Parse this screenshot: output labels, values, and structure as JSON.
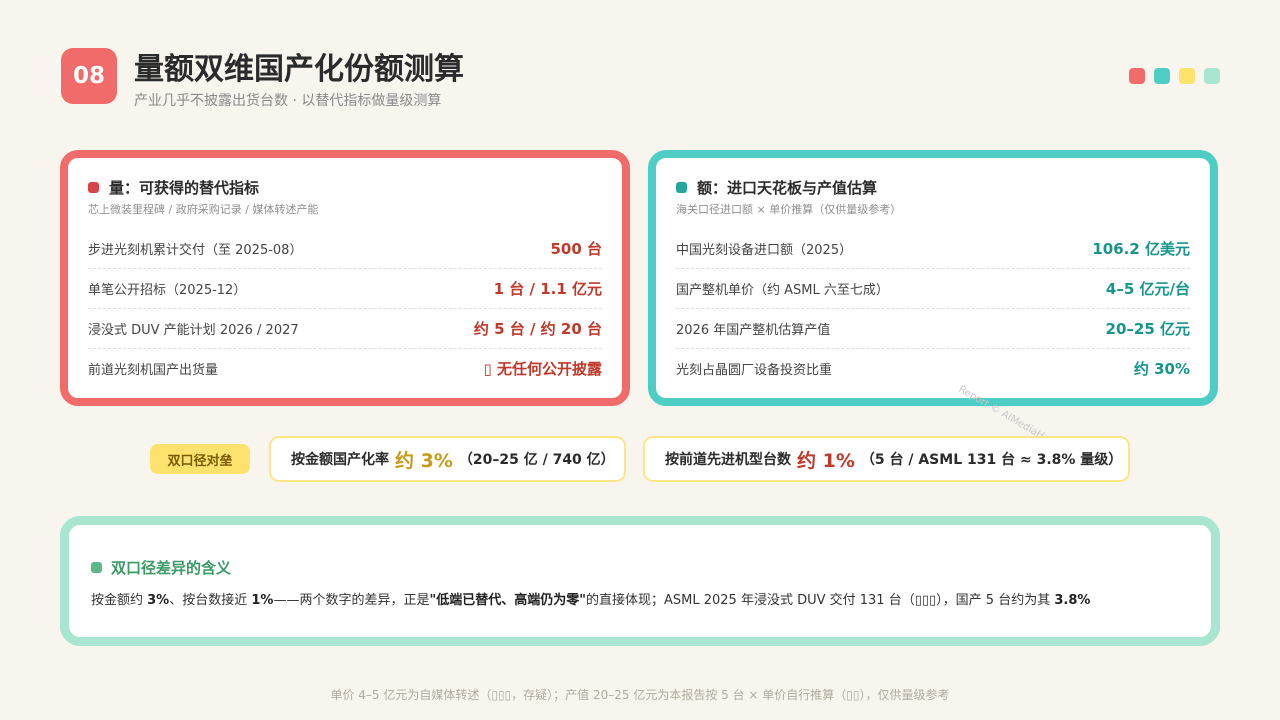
{
  "header": {
    "badge": "08",
    "title": "量额双维国产化份额测算",
    "subtitle": "产业几乎不披露出货台数 · 以替代指标做量级测算",
    "dot_colors": [
      "#f26b6b",
      "#4ecdc4",
      "#fde26d",
      "#a8e6cf"
    ]
  },
  "left_card": {
    "title": "量：可获得的替代指标",
    "subtitle": "芯上微装里程碑 / 政府采购记录 / 媒体转述产能",
    "accent": "#f26b6b",
    "rows": [
      {
        "label": "步进光刻机累计交付（至 2025-08）",
        "value": "500 台"
      },
      {
        "label": "单笔公开招标（2025-12）",
        "value": "1 台 / 1.1 亿元"
      },
      {
        "label": "浸没式 DUV 产能计划 2026 / 2027",
        "value": "约 5 台 / 约 20 台"
      },
      {
        "label": "前道光刻机国产出货量",
        "value": "▯ 无任何公开披露"
      }
    ]
  },
  "right_card": {
    "title": "额：进口天花板与产值估算",
    "subtitle": "海关口径进口额 × 单价推算（仅供量级参考）",
    "accent": "#4ecdc4",
    "rows": [
      {
        "label": "中国光刻设备进口额（2025）",
        "value": "106.2 亿美元"
      },
      {
        "label": "国产整机单价（约 ASML 六至七成）",
        "value": "4–5 亿元/台"
      },
      {
        "label": "2026 年国产整机估算产值",
        "value": "20–25 亿元"
      },
      {
        "label": "光刻占晶圆厂设备投资比重",
        "value": "约 30%"
      }
    ]
  },
  "strip": {
    "tag": "双口径对垒",
    "pill1": {
      "prefix": "按金额国产化率",
      "big": "约 3%",
      "suffix": "（20–25 亿 / 740 亿）"
    },
    "pill2": {
      "prefix": "按前道先进机型台数",
      "big": "约 1%",
      "suffix": "（5 台 / ASML 131 台 ≈ 3.8% 量级）"
    }
  },
  "bottom": {
    "title": "双口径差异的含义",
    "t1": "按金额约 ",
    "b1": "3%",
    "t2": "、按台数接近 ",
    "b2": "1%",
    "t3": "——两个数字的差异，正是",
    "b3": "\"低端已替代、高端仍为零\"",
    "t4": "的直接体现；ASML 2025 年浸没式 DUV 交付 131 台（▯▯▯），国产 5 台约为其 ",
    "b4": "3.8%"
  },
  "footnote": "单价 4–5 亿元为自媒体转述（▯▯▯，存疑）；产值 20–25 亿元为本报告按 5 台 × 单价自行推算（▯▯），仅供量级参考",
  "watermark": "Report © AIMediaHub.com"
}
